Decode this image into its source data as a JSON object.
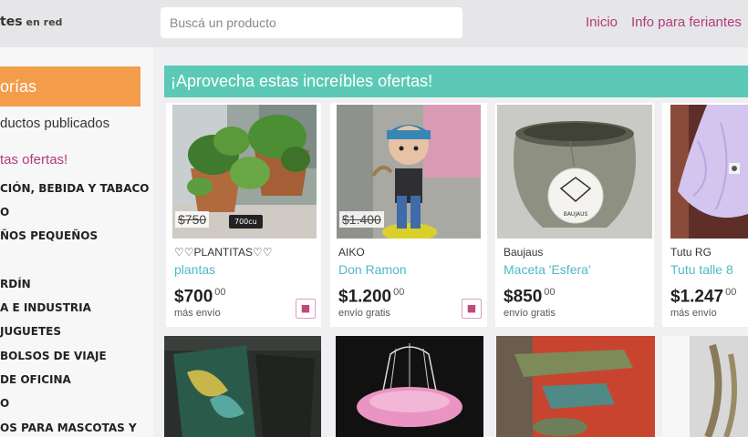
{
  "header": {
    "logo_main": "tes",
    "logo_sub": "en red",
    "search_placeholder": "Buscá un producto",
    "nav": [
      "Inicio",
      "Info para feriantes"
    ]
  },
  "sidebar": {
    "title": "orías",
    "all_products": "ductos publicados",
    "offers": "tas ofertas!",
    "categories": [
      "CIÓN, BEBIDA Y TABACO",
      "O",
      "ÑOS PEQUEÑOS",
      "",
      "RDÍN",
      "A E INDUSTRIA",
      "JUGUETES",
      " BOLSOS DE VIAJE",
      "DE OFICINA",
      "O",
      "OS PARA MASCOTAS Y"
    ]
  },
  "banner": {
    "text": "¡Aprovecha estas increíbles ofertas!"
  },
  "products": [
    {
      "brand": "♡♡PLANTITAS♡♡",
      "name": "plantas",
      "price": "$700",
      "cents": "00",
      "shipping": "más envío",
      "old_price": "$750",
      "tag": "700cu"
    },
    {
      "brand": "AIKO",
      "name": "Don Ramon",
      "price": "$1.200",
      "cents": "00",
      "shipping": "envío gratis",
      "old_price": "$1.400"
    },
    {
      "brand": "Baujaus",
      "name": "Maceta 'Esfera'",
      "price": "$850",
      "cents": "00",
      "shipping": "envío gratis",
      "label": "BAUJAUS"
    },
    {
      "brand": "Tutu RG",
      "name": "Tutu talle 8",
      "price": "$1.247",
      "cents": "00",
      "shipping": "más envío"
    }
  ],
  "colors": {
    "accent_pink": "#b23a78",
    "banner_teal": "#5bc9b6",
    "sidebar_orange": "#f39c4a",
    "link_teal": "#4fb8c8"
  },
  "icons": {
    "favorite": "bookmark-icon"
  }
}
